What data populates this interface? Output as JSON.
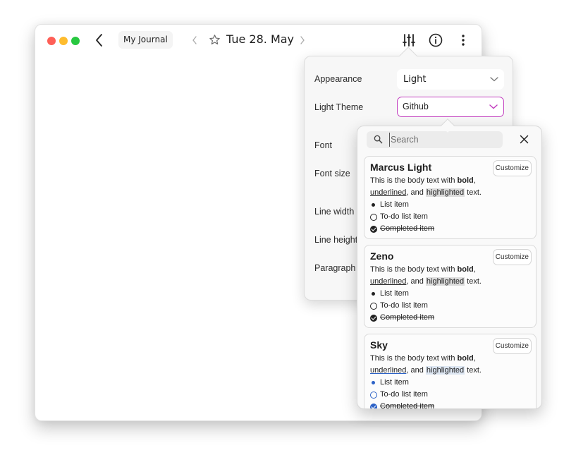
{
  "window": {
    "back_label": "Back",
    "journal_name": "My Journal",
    "date_title": "Tue 28. May"
  },
  "toolbar": {
    "icons": [
      "sliders-icon",
      "info-icon",
      "more-vertical-icon"
    ]
  },
  "settings": {
    "rows": [
      {
        "label": "Appearance",
        "value": "Light"
      },
      {
        "label": "Light Theme",
        "value": "Github"
      },
      {
        "label": "Font"
      },
      {
        "label": "Font size"
      },
      {
        "label": "Line width"
      },
      {
        "label": "Line height"
      },
      {
        "label": "Paragraph S"
      }
    ]
  },
  "theme_picker": {
    "search_placeholder": "Search",
    "search_value": "",
    "preview": {
      "body_prefix": "This is the body text with ",
      "bold": "bold",
      "comma": ",",
      "underlined": "underlined",
      "mid": ", and ",
      "highlighted": "highlighted",
      "suffix": " text.",
      "list_item": "List item",
      "todo_item": "To-do list item",
      "completed_item": "Completed item"
    },
    "customize_label": "Customize",
    "themes": [
      {
        "name": "Marcus Light",
        "accent": "#222222",
        "highlight": "#dcdcdc"
      },
      {
        "name": "Zeno",
        "accent": "#222222",
        "highlight": "#dcdcdc"
      },
      {
        "name": "Sky",
        "accent": "#2c62c7",
        "highlight": "#dde6f2"
      }
    ]
  },
  "colors": {
    "focus_border": "#c23fbf",
    "traffic_close": "#fe5f57",
    "traffic_min": "#febc2e",
    "traffic_max": "#28c840"
  }
}
